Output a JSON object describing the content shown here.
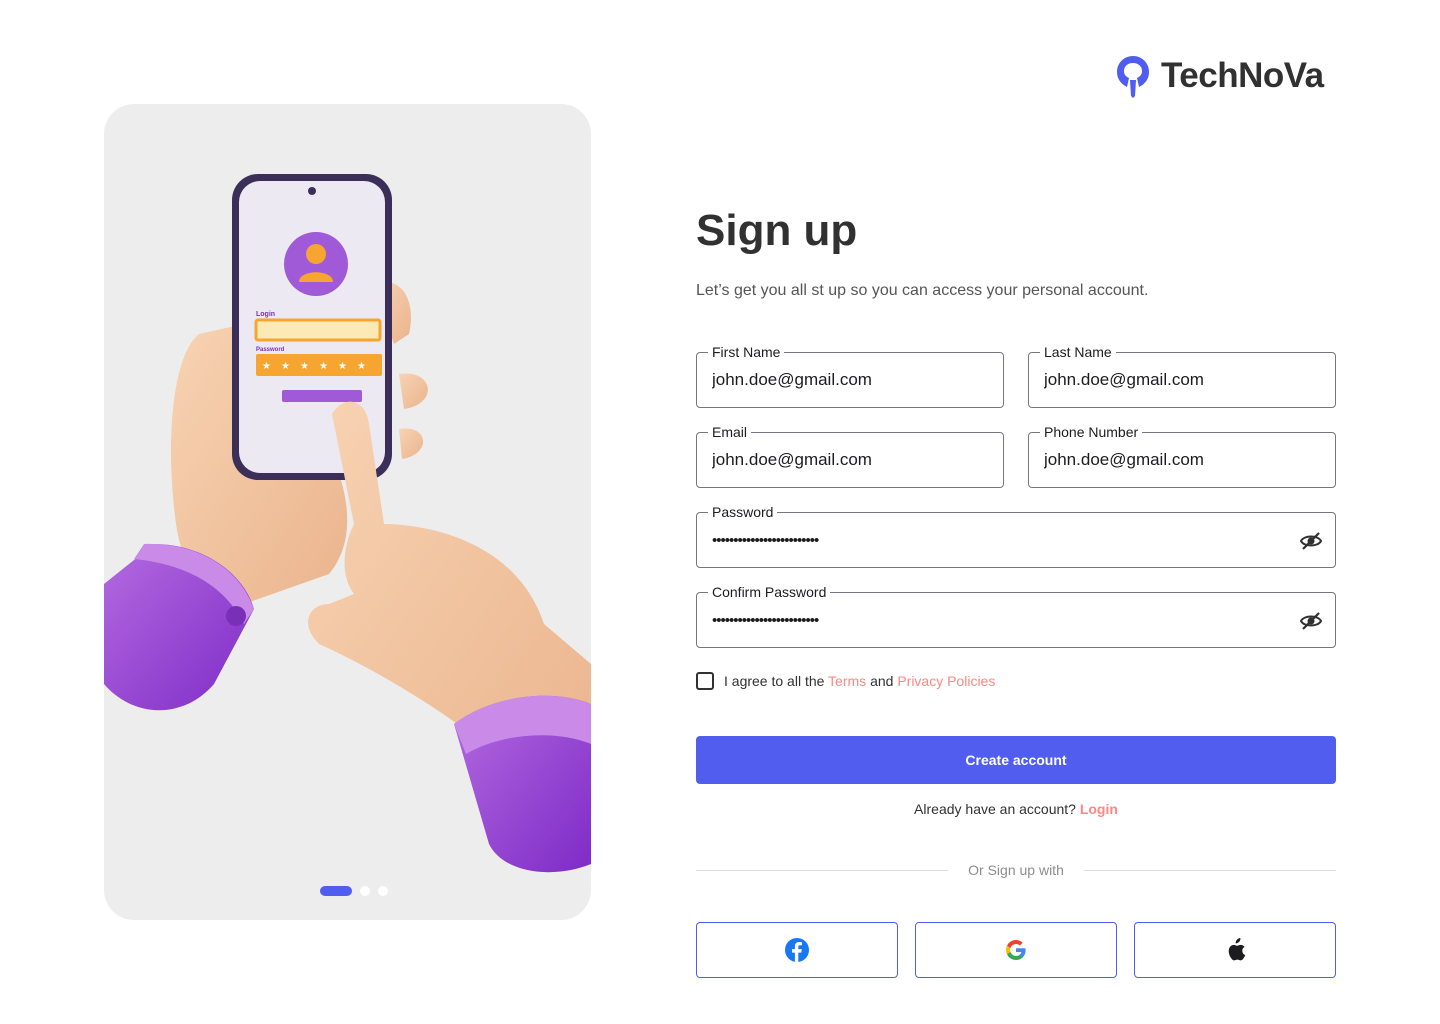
{
  "brand": {
    "name": "TechNoVa",
    "accent": "#515def",
    "link_color": "#ff8682"
  },
  "page": {
    "title": "Sign up",
    "subtitle": "Let’s get you all st up so you can access your personal account."
  },
  "form": {
    "first_name": {
      "label": "First Name",
      "value": "john.doe@gmail.com"
    },
    "last_name": {
      "label": "Last Name",
      "value": "john.doe@gmail.com"
    },
    "email": {
      "label": "Email",
      "value": "john.doe@gmail.com"
    },
    "phone": {
      "label": "Phone Number",
      "value": "john.doe@gmail.com"
    },
    "password": {
      "label": "Password",
      "value": "•••••••••••••••••••••••••"
    },
    "confirm_password": {
      "label": "Confirm Password",
      "value": "•••••••••••••••••••••••••"
    },
    "agree": {
      "prefix": "I agree to all the",
      "terms": "Terms",
      "and": "and",
      "privacy": "Privacy Policies",
      "checked": false
    },
    "submit_label": "Create account",
    "have_account": "Already have an account?",
    "login_link": "Login",
    "divider": "Or Sign up with"
  },
  "social": [
    {
      "icon": "facebook-icon"
    },
    {
      "icon": "google-icon"
    },
    {
      "icon": "apple-icon"
    }
  ],
  "illustration": {
    "phone_login_label": "Login",
    "phone_password_label": "Password",
    "carousel": {
      "total": 3,
      "active": 1
    }
  }
}
